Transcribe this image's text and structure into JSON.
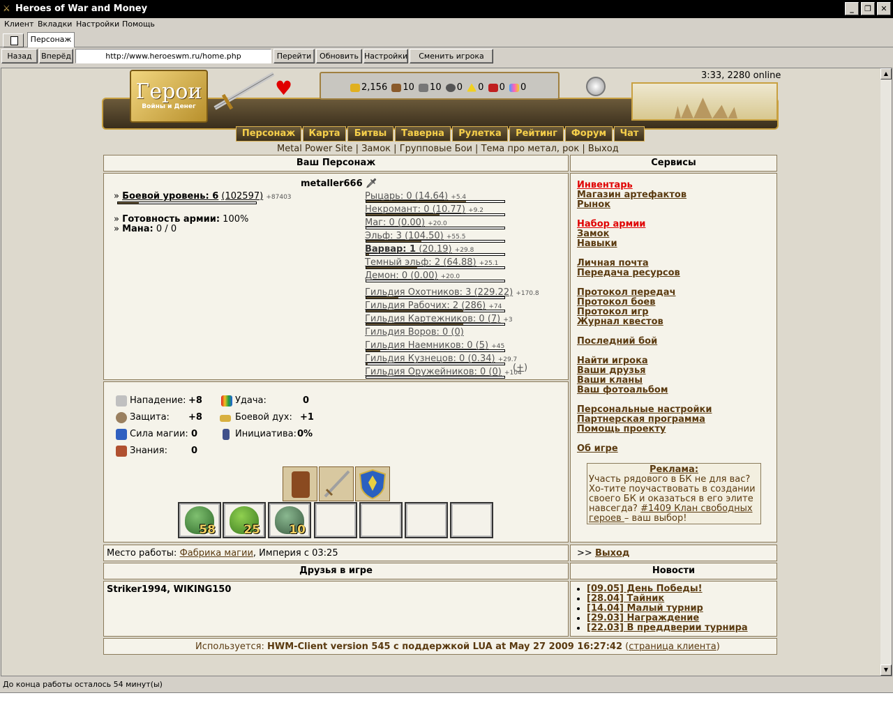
{
  "window": {
    "title": "Heroes of War and Money",
    "controls": [
      "_",
      "❐",
      "✕"
    ]
  },
  "menu": [
    "Клиент",
    "Вкладки",
    "Настройки",
    "Помощь"
  ],
  "tabs": [
    {
      "label": "Персонаж"
    }
  ],
  "toolbar": {
    "back": "Назад",
    "forward": "Вперёд",
    "url": "http://www.heroeswm.ru/home.php",
    "go": "Перейти",
    "refresh": "Обновить",
    "settings": "Настройки",
    "switch_player": "Сменить игрока"
  },
  "header": {
    "logo_title": "Герои",
    "logo_subtitle": "Войны и Денег",
    "online": "3:33, 2280 online",
    "resources": {
      "gold": "2,156",
      "wood": "10",
      "ore": "10",
      "mercury": "0",
      "sulfur": "0",
      "crystals": "0",
      "gems": "0"
    }
  },
  "nav": [
    "Персонаж",
    "Карта",
    "Битвы",
    "Таверна",
    "Рулетка",
    "Рейтинг",
    "Форум",
    "Чат"
  ],
  "sublinks": [
    "Metal Power Site",
    "Замок",
    "Групповые Бои",
    "Тема про метал, рок",
    "Выход"
  ],
  "sublinks_sep": "|",
  "character": {
    "panel_title": "Ваш Персонаж",
    "name": "metaller666",
    "combat_level_label": "Боевой уровень: 6",
    "combat_level_exp": "(102597)",
    "combat_level_next": "+87403",
    "combat_level_progress": 0.15,
    "army_ready_label": "Готовность армии:",
    "army_ready_value": "100%",
    "mana_label": "Мана:",
    "mana_value": "0 / 0",
    "factions": [
      {
        "name": "Рыцарь: 0",
        "value": "(14.64)",
        "next": "+5.4",
        "progress": 0.72
      },
      {
        "name": "Некромант: 0",
        "value": "(10.77)",
        "next": "+9.2",
        "progress": 0.53
      },
      {
        "name": "Маг: 0",
        "value": "(0.00)",
        "next": "+20.0",
        "progress": 0
      },
      {
        "name": "Эльф: 3",
        "value": "(104.50)",
        "next": "+55.5",
        "progress": 0.4
      },
      {
        "name": "Варвар: 1",
        "value": "(20.19)",
        "next": "+29.8",
        "progress": 0.02
      },
      {
        "name": "Темный эльф: 2",
        "value": "(64.88)",
        "next": "+25.1",
        "progress": 0.37
      },
      {
        "name": "Демон: 0",
        "value": "(0.00)",
        "next": "+20.0",
        "progress": 0
      }
    ],
    "guilds": [
      {
        "name": "Гильдия Охотников: 3",
        "value": "(229.22)",
        "next": "+170.8",
        "progress": 0.23
      },
      {
        "name": "Гильдия Рабочих: 2",
        "value": "(286)",
        "next": "+74",
        "progress": 0.7
      },
      {
        "name": "Гильдия Картежников: 0",
        "value": "(7)",
        "next": "+3",
        "progress": 0.7
      },
      {
        "name": "Гильдия Воров: 0",
        "value": "(0)",
        "next": "",
        "progress": 0
      },
      {
        "name": "Гильдия Наемников: 0",
        "value": "(5)",
        "next": "+45",
        "progress": 0.1
      },
      {
        "name": "Гильдия Кузнецов: 0",
        "value": "(0.34)",
        "next": "+29.7",
        "progress": 0.01
      },
      {
        "name": "Гильдия Оружейников: 0",
        "value": "(0)",
        "next": "+104",
        "progress": 0
      }
    ],
    "guild_plus": "+"
  },
  "stats": {
    "attack_label": "Нападение:",
    "attack_value": "+8",
    "defense_label": "Защита:",
    "defense_value": "+8",
    "spellpower_label": "Сила магии:",
    "spellpower_value": "0",
    "knowledge_label": "Знания:",
    "knowledge_value": "0",
    "luck_label": "Удача:",
    "luck_value": "0",
    "morale_label": "Боевой дух:",
    "morale_value": "+1",
    "initiative_label": "Инициатива:",
    "initiative_value": "0%"
  },
  "army": {
    "counts": [
      "58",
      "25",
      "10"
    ]
  },
  "work": {
    "label": "Место работы:",
    "place": "Фабрика магии",
    "rest": ", Империя с 03:25"
  },
  "services": {
    "panel_title": "Сервисы",
    "groups": [
      [
        "Инвентарь",
        "Магазин артефактов",
        "Рынок"
      ],
      [
        "Набор армии",
        "Замок",
        "Навыки"
      ],
      [
        "Личная почта",
        "Передача ресурсов"
      ],
      [
        "Протокол передач",
        "Протокол боев",
        "Протокол игр",
        "Журнал квестов"
      ],
      [
        "Последний бой"
      ],
      [
        "Найти игрока",
        "Ваши друзья",
        "Ваши кланы",
        "Ваш фотоальбом"
      ],
      [
        "Персональные настройки",
        "Партнерская программа",
        "Помощь проекту"
      ],
      [
        "Об игре"
      ]
    ],
    "ad_title": "Реклама:",
    "ad_text": "Участь рядового в БК не для вас? Хо-тите поучаствовать в создании своего БК и оказаться в его элите навсегда?",
    "ad_link": "#1409 Клан свободных героев ",
    "ad_tail": "– ваш выбор!",
    "exit_prefix": ">>",
    "exit": "Выход"
  },
  "friends": {
    "title": "Друзья в игре",
    "list": "Striker1994, WIKING150"
  },
  "news": {
    "title": "Новости",
    "items": [
      "[09.05] День Победы!",
      "[28.04] Тайник",
      "[14.04] Малый турнир",
      "[29.03] Награждение",
      "[22.03] В преддверии турнира"
    ]
  },
  "footer": {
    "prefix": "Используется:",
    "client": "HWM-Client version 545 с поддержкой LUA at May 27 2009 16:27:42",
    "link_open": "(",
    "link": "страница клиента",
    "link_close": ")"
  },
  "status": "До конца работы осталось 54 минут(ы)",
  "colors": {
    "accent": "#5a3a10",
    "alert": "#e00000",
    "panel": "#f5f3ea",
    "nav_text": "#f6cf4a"
  }
}
